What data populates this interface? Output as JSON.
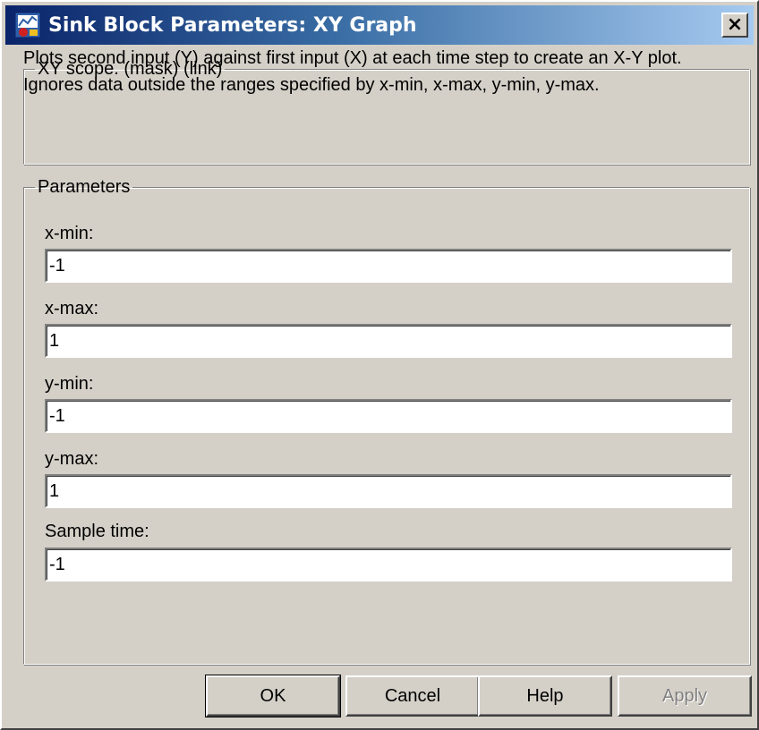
{
  "window": {
    "title": "Sink Block Parameters: XY Graph",
    "close_label": "×"
  },
  "description": {
    "legend": "XY scope. (mask) (link)",
    "text": "Plots second input (Y) against first input (X) at each time step to  create an X-Y plot. Ignores data outside the ranges specified by x-min, x-max, y-min, y-max."
  },
  "parameters": {
    "legend": "Parameters",
    "fields": [
      {
        "label": "x-min:",
        "value": "-1"
      },
      {
        "label": "x-max:",
        "value": "1"
      },
      {
        "label": "y-min:",
        "value": "-1"
      },
      {
        "label": "y-max:",
        "value": "1"
      },
      {
        "label": "Sample time:",
        "value": "-1"
      }
    ]
  },
  "buttons": {
    "ok": "OK",
    "cancel": "Cancel",
    "help": "Help",
    "apply": "Apply"
  },
  "colors": {
    "title_start": "#0a246a",
    "title_end": "#a6caf0",
    "dialog_face": "#d4d0c8"
  },
  "icons": {
    "title": "simulink-block-icon",
    "close": "close-icon"
  }
}
